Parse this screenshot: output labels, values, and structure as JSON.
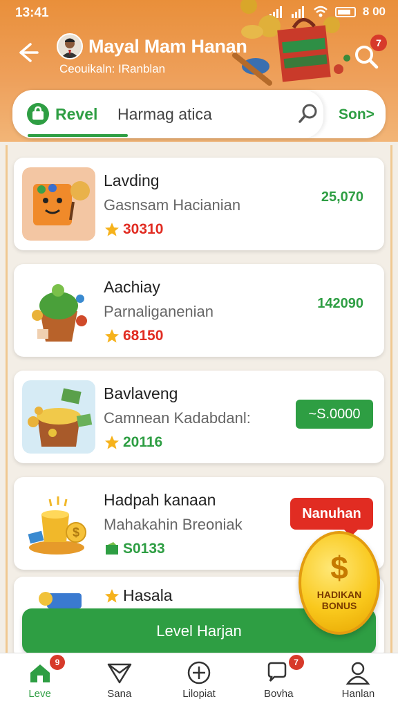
{
  "status": {
    "time": "13:41",
    "right_text": "8 00"
  },
  "header": {
    "user_name": "Mayal Mam Hanan",
    "user_sub": "Ceouikaln: IRanblan",
    "notif_count": "7"
  },
  "search": {
    "label": "Revel",
    "query": "Harmag atica",
    "action": "Son>"
  },
  "cards": [
    {
      "title": "Lavding",
      "sub": "Gasnsam Hacianian",
      "rating": "30310",
      "rating_color": "#e12c22",
      "amount": "25,070"
    },
    {
      "title": "Aachiay",
      "sub": "Parnaliganenian",
      "rating": "68150",
      "rating_color": "#e12c22",
      "amount": "142090"
    },
    {
      "title": "Bavlaveng",
      "sub": "Camnean Kadabdanl:",
      "rating": "20116",
      "rating_color": "#2e9e43",
      "button": "~S.0000"
    },
    {
      "title": "Hadpah kanaan",
      "sub": "Mahakahin Breoniak",
      "rating": "S0133",
      "rating_color": "#2e9e43",
      "tag": "Nanuhan"
    },
    {
      "title": "Hasala"
    }
  ],
  "bonus": {
    "symbol": "$",
    "label": "HADIKAN BONUS"
  },
  "cta": {
    "label": "Level Harjan"
  },
  "nav": [
    {
      "label": "Leve",
      "badge": "9"
    },
    {
      "label": "Sana"
    },
    {
      "label": "Lilopiat"
    },
    {
      "label": "Bovha",
      "badge": "7"
    },
    {
      "label": "Hanlan"
    }
  ],
  "colors": {
    "accent_green": "#2e9e43",
    "header_orange": "#e98f3a",
    "alert_red": "#e12c22"
  }
}
